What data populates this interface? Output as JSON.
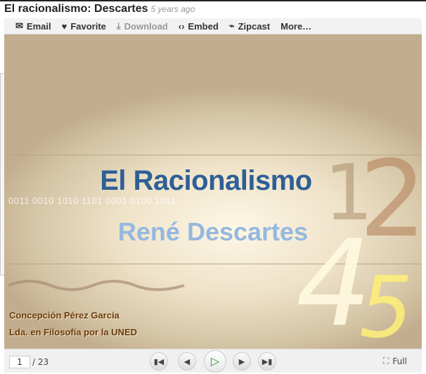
{
  "header": {
    "title": "El racionalismo: Descartes",
    "age": "5 years ago"
  },
  "toolbar": {
    "items": [
      {
        "label": "Email",
        "icon": "envelope-icon"
      },
      {
        "label": "Favorite",
        "icon": "heart-icon"
      },
      {
        "label": "Download",
        "icon": "download-icon"
      },
      {
        "label": "Embed",
        "icon": "code-icon"
      },
      {
        "label": "Zipcast",
        "icon": "zipcast-icon"
      },
      {
        "label": "More…"
      }
    ]
  },
  "slide": {
    "title": "El Racionalismo",
    "subtitle": "René Descartes",
    "binary": "0011 0010 1010 1101 0001 0100 1011",
    "numbers": [
      "1",
      "2",
      "4",
      "5"
    ],
    "author": "Concepción Pérez García",
    "degree": "Lda. en Filosofía por la UNED"
  },
  "controls": {
    "page": "1",
    "total": "/ 23",
    "full_label": "Full"
  }
}
